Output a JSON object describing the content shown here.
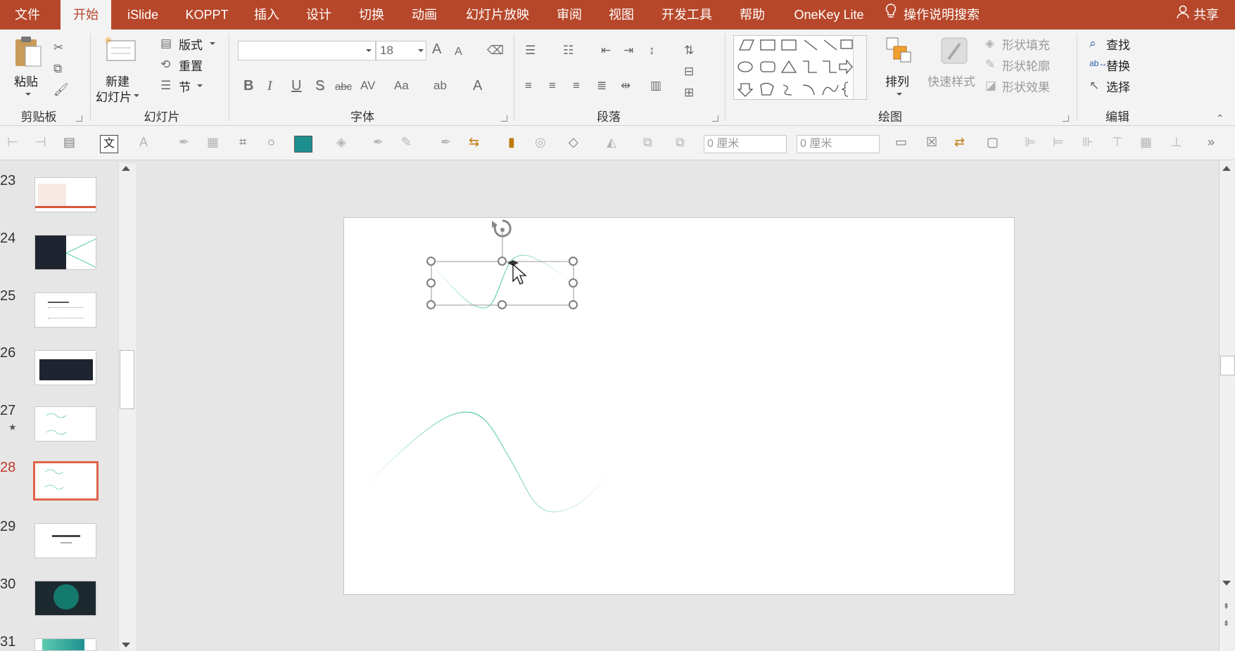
{
  "tabs": [
    "文件",
    "开始",
    "iSlide",
    "KOPPT",
    "插入",
    "设计",
    "切换",
    "动画",
    "幻灯片放映",
    "审阅",
    "视图",
    "开发工具",
    "帮助",
    "OneKey Lite"
  ],
  "active_tab": "开始",
  "search_label": "操作说明搜索",
  "share_label": "共享",
  "clipboard": {
    "paste": "粘贴",
    "group": "剪贴板"
  },
  "slides_group": {
    "new_slide_line1": "新建",
    "new_slide_line2": "幻灯片",
    "layout": "版式",
    "reset": "重置",
    "section": "节",
    "group": "幻灯片"
  },
  "font_group": {
    "font_size": "18",
    "group": "字体",
    "bold": "B",
    "italic": "I",
    "underline": "U",
    "shadow": "S",
    "strike": "abc",
    "case": "Aa",
    "grow": "A",
    "shrink": "A"
  },
  "paragraph_group": {
    "group": "段落"
  },
  "drawing_group": {
    "arrange": "排列",
    "quick_styles": "快速样式",
    "shape_fill": "形状填充",
    "shape_outline": "形状轮廓",
    "shape_effects": "形状效果",
    "group": "绘图"
  },
  "editing_group": {
    "find": "查找",
    "replace": "替换",
    "select": "选择",
    "group": "编辑"
  },
  "toolbar2": {
    "width_value": "0 厘米",
    "height_value": "0 厘米",
    "text_icon": "文"
  },
  "slide_numbers": [
    "23",
    "24",
    "25",
    "26",
    "27",
    "28",
    "29",
    "30",
    "31"
  ],
  "active_slide": "28",
  "colors": {
    "accent": "#b7472a",
    "curve": "#5ccbb0",
    "selected_border": "#e0634a"
  }
}
